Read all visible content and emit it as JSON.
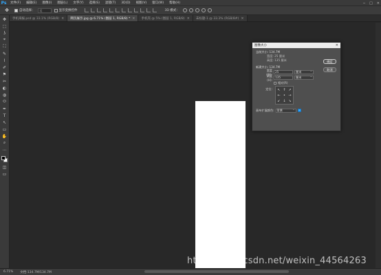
{
  "app": {
    "logo": "Ps"
  },
  "menubar": {
    "items": [
      "文件(F)",
      "编辑(E)",
      "图像(I)",
      "图层(L)",
      "文字(Y)",
      "选择(S)",
      "滤镜(T)",
      "3D(D)",
      "视图(V)",
      "窗口(W)",
      "帮助(H)"
    ],
    "window_controls": [
      "─",
      "□",
      "✕"
    ]
  },
  "options": {
    "auto_select_label": "自动选择：",
    "auto_select_value": "组",
    "transform_label": "显示变换控件",
    "mode_3d_label": "3D 模式："
  },
  "tabs": [
    {
      "label": "手机海报.psd @ 33.1% (RGB/8)",
      "active": false
    },
    {
      "label": "网页展示.jpg @ 6.71% (图层 1, RGB/8) *",
      "active": true
    },
    {
      "label": "手机壳 @ 5% (图层 1, RGB/8)",
      "active": false
    },
    {
      "label": "未标题-1 @ 33.3% (RGB/8#)",
      "active": false
    }
  ],
  "status": {
    "zoom": "6.71%",
    "doc_info": "文档:134.7M/134.7M"
  },
  "dialog": {
    "title": "图像大小",
    "current_size_label": "当前大小: 134.7M",
    "current_width": "宽度:   25 厘米",
    "current_height": "高度:  135 厘米",
    "new_size_label": "新建大小: 134.7M",
    "width_label": "宽度(W):",
    "width_value": "25",
    "width_unit": "厘米",
    "height_label": "高度(H):",
    "height_value": "135",
    "height_unit": "厘米",
    "relative_label": "相对(R)",
    "anchor_label": "定位:",
    "anchor_arrows": [
      "↖",
      "↑",
      "↗",
      "←",
      "•",
      "→",
      "↙",
      "↓",
      "↘"
    ],
    "extension_label": "画布扩展颜色:",
    "extension_value": "背景",
    "extension_color": "#31a8ff",
    "ok_label": "确定",
    "cancel_label": "取消"
  },
  "watermark": "https://blog.csdn.net/weixin_44564263",
  "tools": [
    "✥",
    "⬚",
    "ʖ",
    "⌖",
    "⛶",
    "✎",
    "⌇",
    "✐",
    "⚑",
    "✂",
    "◐",
    "◍",
    "⬭",
    "✒",
    "T",
    "↖",
    "▭",
    "✋",
    "⌕",
    "⋯"
  ]
}
